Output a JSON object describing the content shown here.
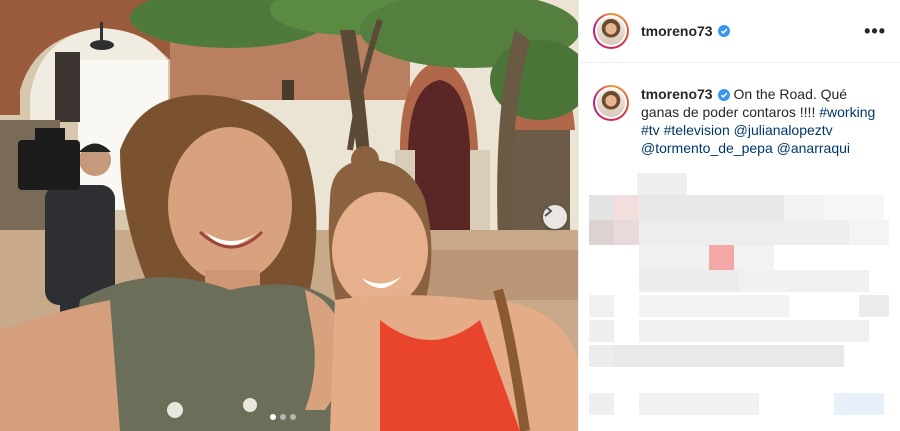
{
  "post": {
    "username": "tmoreno73",
    "verified": true,
    "more_label": "•••",
    "caption": {
      "username": "tmoreno73",
      "text_lines": [
        "On the Road. Qué",
        "ganas de poder contaros !!!!"
      ],
      "hashtags": [
        "#working",
        "#tv",
        "#television"
      ],
      "mentions": [
        "@julianalopeztv",
        "@tormento_de_pepa",
        "@anarraqui"
      ]
    },
    "carousel": {
      "slides": 3,
      "current": 1
    }
  },
  "colors": {
    "verified": "#3897f0",
    "link": "#00376b",
    "text": "#262626",
    "border": "#efefef",
    "story_ring": "#dc2743"
  },
  "icons": {
    "next": "chevron-right-icon",
    "verified": "verified-badge-icon",
    "more": "more-options-icon"
  }
}
